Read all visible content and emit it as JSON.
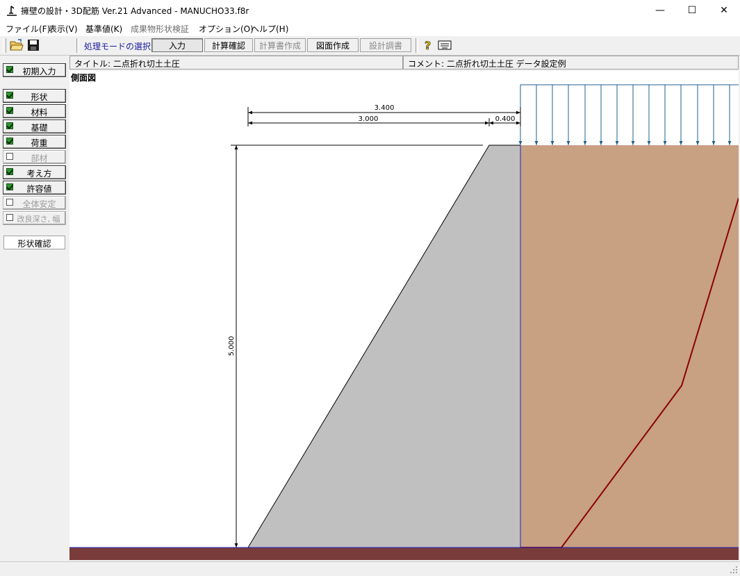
{
  "window": {
    "title": "擁壁の設計・3D配筋 Ver.21 Advanced  - MANUCHO33.f8r",
    "minimize_glyph": "—",
    "maximize_glyph": "☐",
    "close_glyph": "✕"
  },
  "menu": [
    {
      "label": "ファイル(F)",
      "enabled": true
    },
    {
      "label": "表示(V)",
      "enabled": true
    },
    {
      "label": "基準値(K)",
      "enabled": true
    },
    {
      "label": "成果物形状検証",
      "enabled": false
    },
    {
      "label": "オプション(O)",
      "enabled": true
    },
    {
      "label": "ヘルプ(H)",
      "enabled": true
    }
  ],
  "toolbar": {
    "mode_label": "処理モードの選択",
    "buttons": [
      {
        "label": "入力",
        "state": "active"
      },
      {
        "label": "計算確認",
        "state": "normal"
      },
      {
        "label": "計算書作成",
        "state": "disabled"
      },
      {
        "label": "図面作成",
        "state": "normal"
      },
      {
        "label": "設計調書",
        "state": "disabled"
      }
    ],
    "icons": [
      "open-folder-icon",
      "save-disk-icon",
      "help-question-icon",
      "keyboard-icon"
    ]
  },
  "header": {
    "title_field": "タイトル: 二点折れ切土土圧",
    "comment_field": "コメント: 二点折れ切土土圧 データ設定例"
  },
  "sidebar": {
    "initial_input": {
      "label": "初期入力",
      "checked": true
    },
    "items": [
      {
        "label": "形状",
        "checked": true,
        "enabled": true
      },
      {
        "label": "材料",
        "checked": true,
        "enabled": true
      },
      {
        "label": "基礎",
        "checked": true,
        "enabled": true
      },
      {
        "label": "荷重",
        "checked": true,
        "enabled": true
      },
      {
        "label": "部材",
        "checked": false,
        "enabled": false
      },
      {
        "label": "考え方",
        "checked": true,
        "enabled": true
      },
      {
        "label": "許容値",
        "checked": true,
        "enabled": true
      },
      {
        "label": "全体安定",
        "checked": false,
        "enabled": false
      },
      {
        "label": "改良深さ, 幅",
        "checked": false,
        "enabled": false
      }
    ],
    "shape_check": "形状確認"
  },
  "drawing": {
    "view_label": "側面図",
    "dim_total_width": "3.400",
    "dim_slope_width": "3.000",
    "dim_top_width": "0.400",
    "dim_height": "5.000",
    "colors": {
      "wall": "#c0c0c0",
      "soil": "#c8a082",
      "ground": "#7a3b3b",
      "slip_line": "#8b0000",
      "load_arrow": "#1f5f8b",
      "boundary": "#2020c0"
    }
  }
}
